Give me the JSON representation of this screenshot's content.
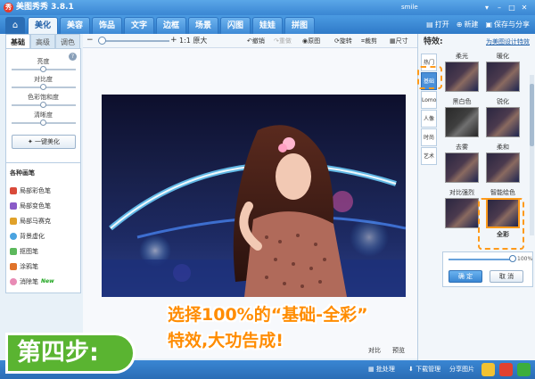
{
  "app": {
    "title": "美图秀秀 3.8.1",
    "user": "smile"
  },
  "menu": {
    "home_icon": "⌂",
    "tabs": [
      "美化",
      "美容",
      "饰品",
      "文字",
      "边框",
      "场景",
      "闪图",
      "娃娃",
      "拼图"
    ],
    "actions": {
      "open": "打开",
      "new": "新建",
      "save_share": "保存与分享"
    }
  },
  "toolbar": {
    "zoom_minus": "−",
    "zoom_plus": "+",
    "ratio_label": "1:1 原大",
    "undo": "撤销",
    "redo": "重做",
    "original": "原图",
    "rotate": "旋转",
    "crop": "裁剪",
    "size": "尺寸"
  },
  "left_panel": {
    "tabs": [
      "基础",
      "高级",
      "调色"
    ],
    "help": "?",
    "sliders": [
      {
        "label": "亮度",
        "value": 0.5
      },
      {
        "label": "对比度",
        "value": 0.5
      },
      {
        "label": "色彩饱和度",
        "value": 0.5
      },
      {
        "label": "清晰度",
        "value": 0.5
      }
    ],
    "onekey_label": "一键美化",
    "brush_title": "各种画笔",
    "brushes": [
      {
        "label": "局部彩色笔",
        "color": "#d94a3a"
      },
      {
        "label": "局部变色笔",
        "color": "#8a5bc8"
      },
      {
        "label": "局部马赛克",
        "color": "#e0a12a"
      },
      {
        "label": "背景虚化",
        "color": "#4aa3e0"
      },
      {
        "label": "抠图笔",
        "color": "#5cb85c"
      },
      {
        "label": "涂鸦笔",
        "color": "#e0732a"
      },
      {
        "label": "消除笔",
        "color": "#e88bb5",
        "badge": "New"
      }
    ]
  },
  "canvas": {
    "compare": "对比",
    "preview": "预览"
  },
  "right_panel": {
    "title": "特效:",
    "link": "为美图设计特效",
    "categories": [
      "热门",
      "基础",
      "Lomo",
      "人像",
      "时尚",
      "艺术"
    ],
    "active_category": "基础",
    "effects": [
      "柔光",
      "暖化",
      "黑白色",
      "锐化",
      "去雾",
      "柔和",
      "对比强烈",
      "智能绘色",
      "全彩"
    ],
    "selected_effect": "全彩",
    "strength": {
      "value": 1.0,
      "label": "100%"
    },
    "ok": "确 定",
    "cancel": "取 消"
  },
  "bottombar": {
    "batch": "批处理",
    "download": "下载管理",
    "share": "分享图片"
  },
  "overlay": {
    "step": "第四步:",
    "caption_line1": "选择100%的“基础-全彩”",
    "caption_line2": "特效,大功告成!"
  },
  "colors": {
    "accent_blue": "#3a86d3",
    "highlight_orange": "#ff9a1a",
    "step_green": "#5ab431"
  }
}
